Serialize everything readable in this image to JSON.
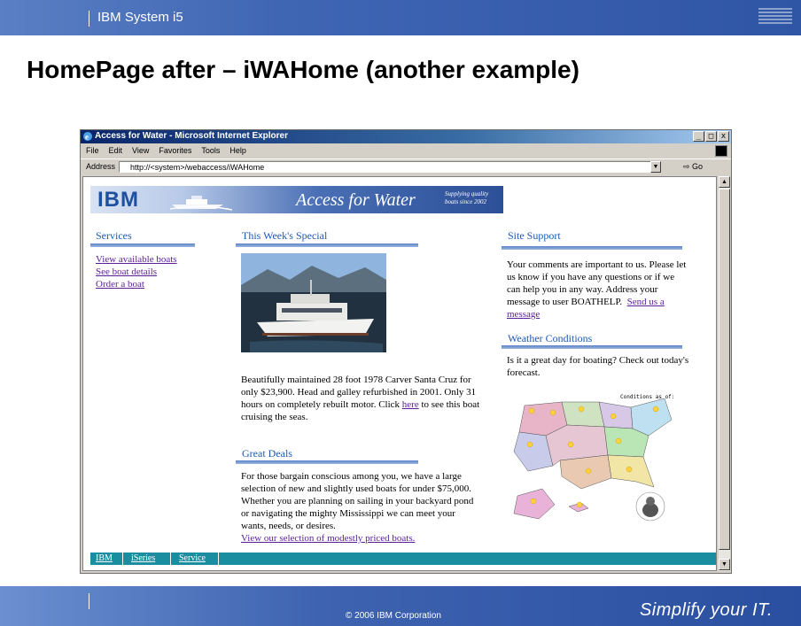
{
  "slide": {
    "brand": "IBM System i5",
    "title": "HomePage after – iWAHome (another example)",
    "copyright": "© 2006 IBM Corporation",
    "tagline": "Simplify your IT."
  },
  "browser": {
    "window_title": "Access for Water - Microsoft Internet Explorer",
    "menu": [
      "File",
      "Edit",
      "View",
      "Favorites",
      "Tools",
      "Help"
    ],
    "address_label": "Address",
    "url": "http://<system>/webaccess/iWAHome",
    "go_label": "Go"
  },
  "page": {
    "banner": {
      "logo": "IBM",
      "title": "Access for Water",
      "tagline_line1": "Supplying quality",
      "tagline_line2": "boats since 2002"
    },
    "services": {
      "heading": "Services",
      "links": [
        "View available boats",
        "See boat details",
        "Order a boat"
      ]
    },
    "special": {
      "heading": "This Week's Special",
      "text_before_link": "Beautifully maintained 28 foot 1978 Carver Santa Cruz for only $23,900. Head and galley refurbished in 2001. Only 31 hours on completely rebuilt motor. Click ",
      "link": "here",
      "text_after_link": " to see this boat cruising the seas."
    },
    "deals": {
      "heading": "Great Deals",
      "text": "For those bargain conscious among you, we have a large selection of new and slightly used boats for under $75,000. Whether you are planning on sailing in your backyard pond or navigating the mighty Mississippi we can meet your wants, needs, or desires.",
      "link": "View our selection of modestly priced boats."
    },
    "support": {
      "heading": "Site Support",
      "text": "Your comments are important to us. Please let us know if you have any questions or if we can help you in any way. Address your message to user BOATHELP.",
      "link": "Send us a message"
    },
    "weather": {
      "heading": "Weather Conditions",
      "text": "Is it a great day for boating? Check out today's forecast.",
      "map_caption": "Conditions as of:"
    },
    "footer_links": [
      "IBM",
      "iSeries",
      "Service"
    ]
  },
  "colors": {
    "slide_blue": "#3f66b3",
    "heading_blue": "#1f57b0",
    "visited_link": "#5a1e96",
    "footer_teal": "#1a8ea0"
  }
}
